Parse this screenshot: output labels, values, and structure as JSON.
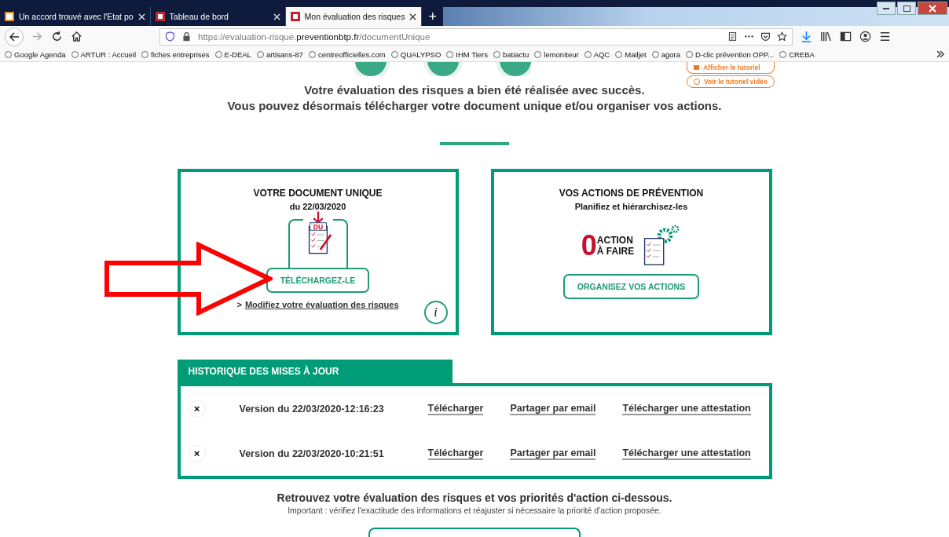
{
  "browser": {
    "tabs": [
      {
        "title": "Un accord trouvé avec l'Etat po",
        "selected": false
      },
      {
        "title": "Tableau de bord",
        "selected": false
      },
      {
        "title": "Mon évaluation des risques",
        "selected": true
      }
    ],
    "new_tab": "+",
    "url": {
      "prefix": "https://evaluation-risque.",
      "domain": "preventionbtp.fr",
      "path": "/documentUnique"
    },
    "bookmarks": [
      "Google Agenda",
      "ARTUR : Accueil",
      "fiches entreprises",
      "E-DEAL",
      "artisans-87",
      "centreofficielles.com",
      "QUALYPSO",
      "IHM Tiers",
      "batiactu",
      "lemoniteur",
      "AQC",
      "Mailjet",
      "agora",
      "D-clic prévention OPP...",
      "CREBA"
    ]
  },
  "tutorial_buttons": [
    "Afficher le tutoriel",
    "Voir le tutoriel vidéo"
  ],
  "intro": [
    "Votre évaluation des risques a bien été réalisée avec succès.",
    "Vous pouvez désormais télécharger votre document unique et/ou organiser vos actions."
  ],
  "document_card": {
    "title": "VOTRE DOCUMENT UNIQUE",
    "date": "du 22/03/2020",
    "badge": "DU",
    "button": "TÉLÉCHARGEZ-LE",
    "link_prefix": ">",
    "link": "Modifiez votre évaluation des risques",
    "info": "i"
  },
  "actions_card": {
    "title": "VOS ACTIONS DE PRÉVENTION",
    "subtitle": "Planifiez et hiérarchisez-les",
    "count": "0",
    "count_label": [
      "ACTION",
      "À FAIRE"
    ],
    "button": "ORGANISEZ VOS ACTIONS"
  },
  "history": {
    "title": "HISTORIQUE DES MISES À JOUR",
    "rows": [
      {
        "delete": "×",
        "version": "Version du 22/03/2020-12:16:23",
        "links": [
          "Télécharger",
          "Partager par email",
          "Télécharger une attestation"
        ]
      },
      {
        "delete": "×",
        "version": "Version du 22/03/2020-10:21:51",
        "links": [
          "Télécharger",
          "Partager par email",
          "Télécharger une attestation"
        ]
      }
    ]
  },
  "footer": {
    "heading": "Retrouvez votre évaluation des risques et vos priorités d'action ci-dessous.",
    "note": "Important : vérifiez l'exactitude des informations et réajuster si nécessaire la priorité d'action proposée."
  }
}
